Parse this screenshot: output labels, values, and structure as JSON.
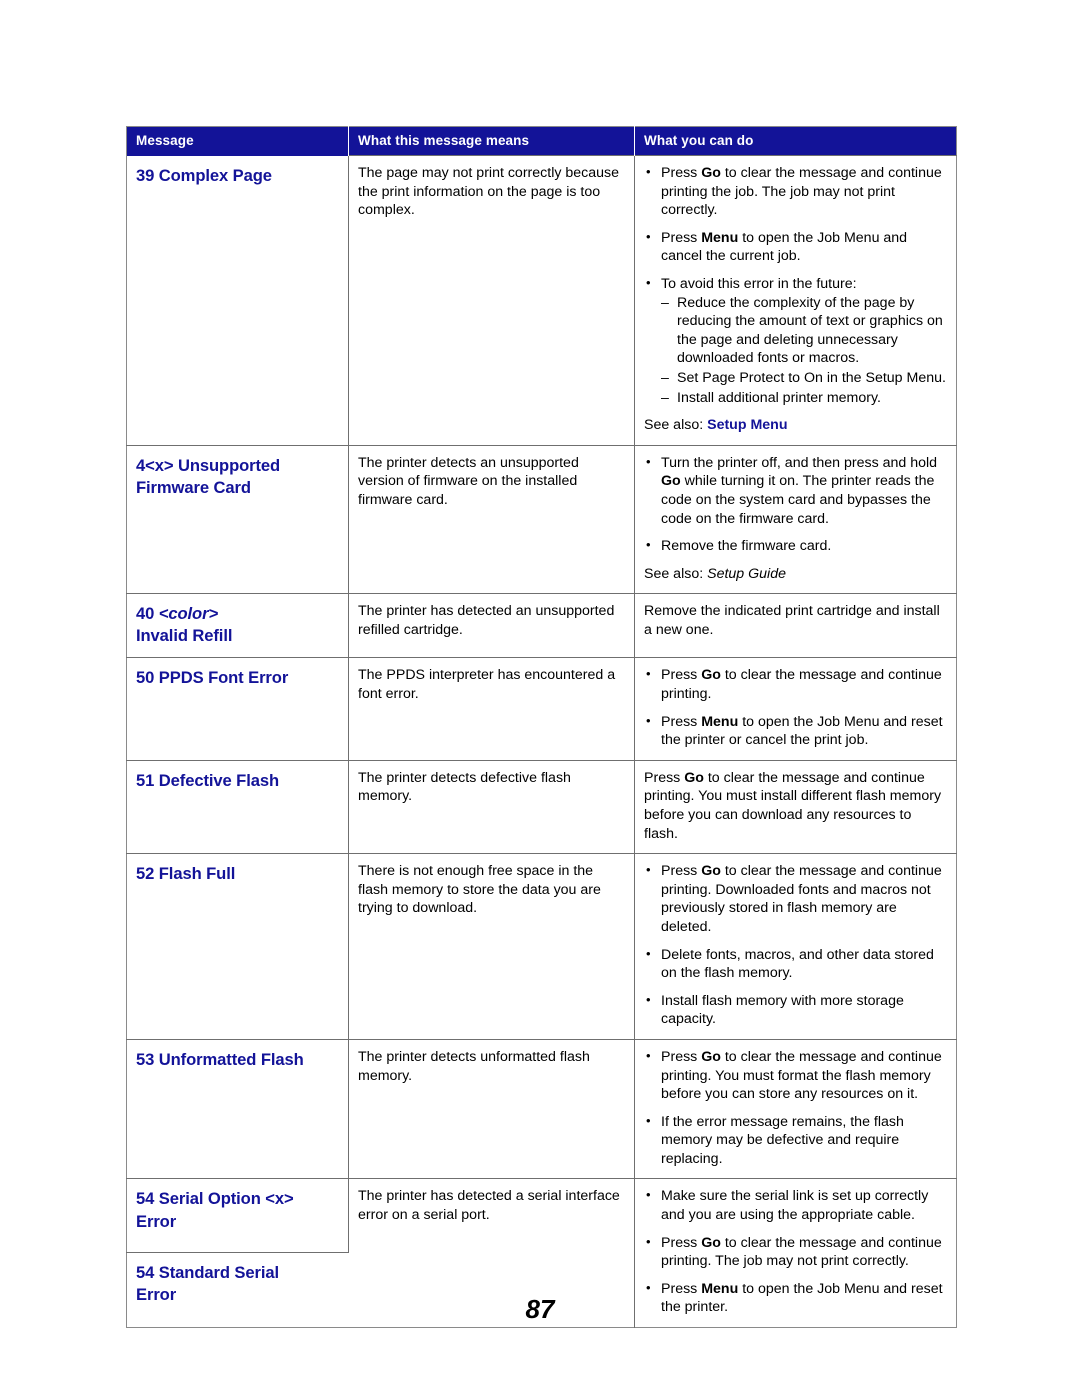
{
  "document": {
    "page_number": "87"
  },
  "table": {
    "headers": {
      "message": "Message",
      "means": "What this message means",
      "can_do": "What you can do"
    },
    "rows": [
      {
        "message_prefix": "39 Complex Page",
        "message_suffix": "",
        "means": "The page may not print correctly because the print information on the page is too complex.",
        "actions": [
          {
            "pre": "Press ",
            "kw": "Go",
            "post": " to clear the message and continue printing the job. The job may not print correctly."
          },
          {
            "pre": "Press ",
            "kw": "Menu",
            "post": " to open the Job Menu and cancel the current job."
          },
          {
            "pre": "To avoid this error in the future:",
            "kw": "",
            "post": "",
            "sub": [
              "Reduce the complexity of the page by reducing the amount of text or graphics on the page and deleting unnecessary downloaded fonts or macros.",
              "Set Page Protect to On in the Setup Menu.",
              "Install additional printer memory."
            ]
          }
        ],
        "see_also_label": "See also: ",
        "see_also_value": "Setup Menu",
        "see_also_style": "link"
      },
      {
        "message_prefix": "4<x> Unsupported",
        "message_suffix": "Firmware Card",
        "means": "The printer detects an unsupported version of firmware on the installed firmware card.",
        "actions": [
          {
            "pre": "Turn the printer off, and then press and hold ",
            "kw": "Go",
            "post": " while turning it on. The printer reads the code on the system card and bypasses the code on the firmware card."
          },
          {
            "pre": "Remove the firmware card.",
            "kw": "",
            "post": ""
          }
        ],
        "see_also_label": "See also: ",
        "see_also_value": "Setup Guide",
        "see_also_style": "italic"
      },
      {
        "message_prefix": "40 <color>",
        "message_suffix": "Invalid Refill",
        "message_italic_part": "<color>",
        "means": "The printer has detected an unsupported refilled cartridge.",
        "plain_action": "Remove the indicated print cartridge and install a new one."
      },
      {
        "message_prefix": "50 PPDS Font Error",
        "message_suffix": "",
        "means": "The PPDS interpreter has encountered a font error.",
        "actions": [
          {
            "pre": "Press ",
            "kw": "Go",
            "post": " to clear the message and continue printing."
          },
          {
            "pre": "Press ",
            "kw": "Menu",
            "post": " to open the Job Menu and reset the printer or cancel the print job."
          }
        ]
      },
      {
        "message_prefix": "51 Defective Flash",
        "message_suffix": "",
        "means": "The printer detects defective flash memory.",
        "plain_action_pre": "Press ",
        "plain_action_kw": "Go",
        "plain_action_post": " to clear the message and continue printing. You must install different flash memory before you can download any resources to flash."
      },
      {
        "message_prefix": "52 Flash Full",
        "message_suffix": "",
        "means": "There is not enough free space in the flash memory to store the data you are trying to download.",
        "actions": [
          {
            "pre": "Press ",
            "kw": "Go",
            "post": " to clear the message and continue printing. Downloaded fonts and macros not previously stored in flash memory are deleted."
          },
          {
            "pre": "Delete fonts, macros, and other data stored on the flash memory.",
            "kw": "",
            "post": ""
          },
          {
            "pre": "Install flash memory with more storage capacity.",
            "kw": "",
            "post": ""
          }
        ]
      },
      {
        "message_prefix": "53 Unformatted Flash",
        "message_suffix": "",
        "means": "The printer detects unformatted flash memory.",
        "actions": [
          {
            "pre": "Press ",
            "kw": "Go",
            "post": " to clear the message and continue printing. You must format the flash memory before you can store any resources on it."
          },
          {
            "pre": "If the error message remains, the flash memory may be defective and require replacing.",
            "kw": "",
            "post": ""
          }
        ]
      },
      {
        "message_prefix": "54 Serial Option <x>",
        "message_suffix": "Error",
        "message_prefix_2": "54 Standard Serial",
        "message_suffix_2": "Error",
        "means": "The printer has detected a serial interface error on a serial port.",
        "actions": [
          {
            "pre": "Make sure the serial link is set up correctly and you are using the appropriate cable.",
            "kw": "",
            "post": ""
          },
          {
            "pre": "Press ",
            "kw": "Go",
            "post": " to clear the message and continue printing. The job may not print correctly."
          },
          {
            "pre": "Press ",
            "kw": "Menu",
            "post": " to open the Job Menu and reset the printer."
          }
        ]
      }
    ]
  }
}
